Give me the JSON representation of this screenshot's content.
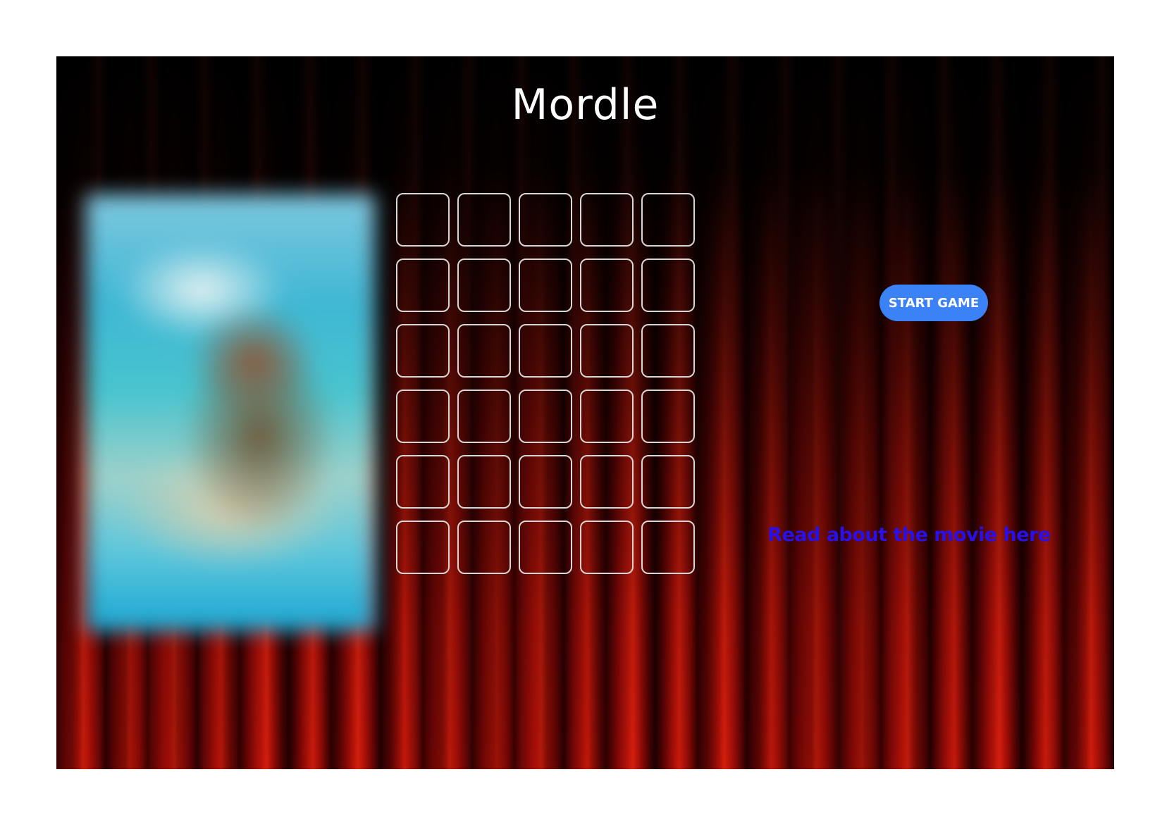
{
  "app": {
    "title": "Mordle"
  },
  "poster": {
    "state": "blurred",
    "icon": "movie-poster-image",
    "colors": {
      "sky": "#7fc8e0",
      "sea": "#1aa7d3"
    }
  },
  "board": {
    "rows": 6,
    "columns": 5,
    "tiles": [
      [
        "",
        "",
        "",
        "",
        ""
      ],
      [
        "",
        "",
        "",
        "",
        ""
      ],
      [
        "",
        "",
        "",
        "",
        ""
      ],
      [
        "",
        "",
        "",
        "",
        ""
      ],
      [
        "",
        "",
        "",
        "",
        ""
      ],
      [
        "",
        "",
        "",
        "",
        ""
      ]
    ],
    "tile_border_color": "#d7d7d7"
  },
  "controls": {
    "start_label": "START GAME",
    "start_color": "#3b82f6"
  },
  "links": {
    "movie_label": "Read about the movie here",
    "movie_color": "#2a10e8"
  },
  "theme": {
    "background": "red-curtain",
    "curtain_color": "#c01208"
  }
}
